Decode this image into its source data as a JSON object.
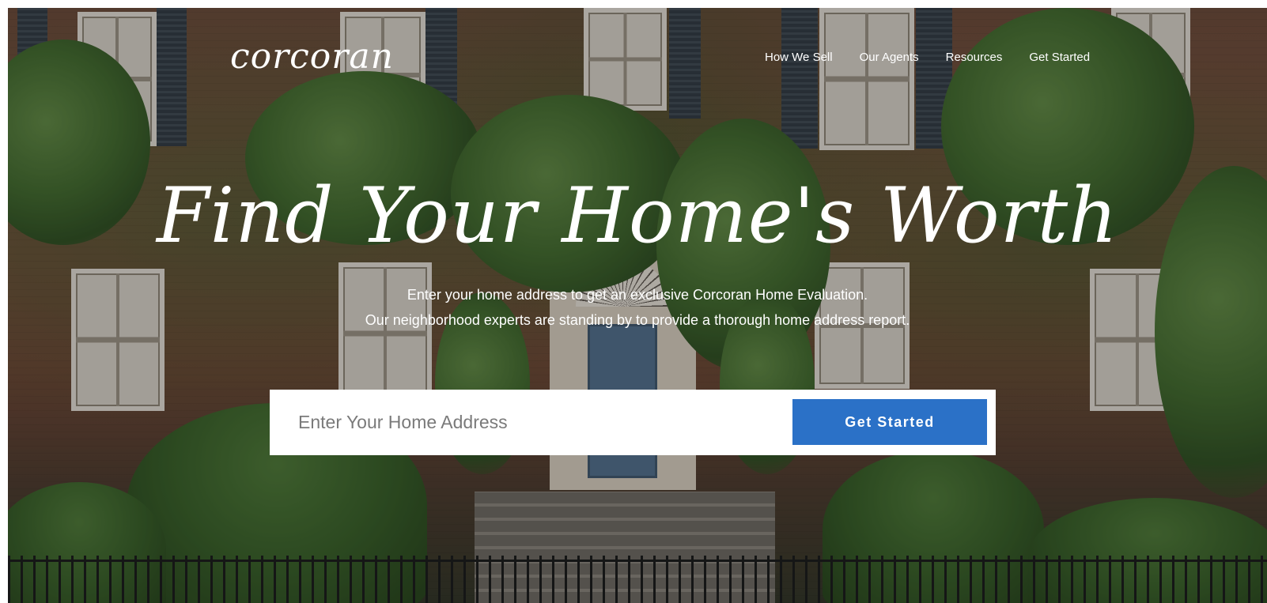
{
  "header": {
    "logo_text": "corcoran",
    "nav": [
      {
        "label": "How We Sell"
      },
      {
        "label": "Our Agents"
      },
      {
        "label": "Resources"
      },
      {
        "label": "Get Started"
      }
    ]
  },
  "hero": {
    "headline": "Find Your Home's Worth",
    "subtext_line1": "Enter your home address to get an exclusive Corcoran Home Evaluation.",
    "subtext_line2": "Our neighborhood experts are standing by to provide a thorough home address report."
  },
  "search": {
    "placeholder": "Enter Your Home Address",
    "value": "",
    "button_label": "Get Started"
  },
  "colors": {
    "accent": "#2b71c7",
    "text_on_image": "#ffffff"
  }
}
